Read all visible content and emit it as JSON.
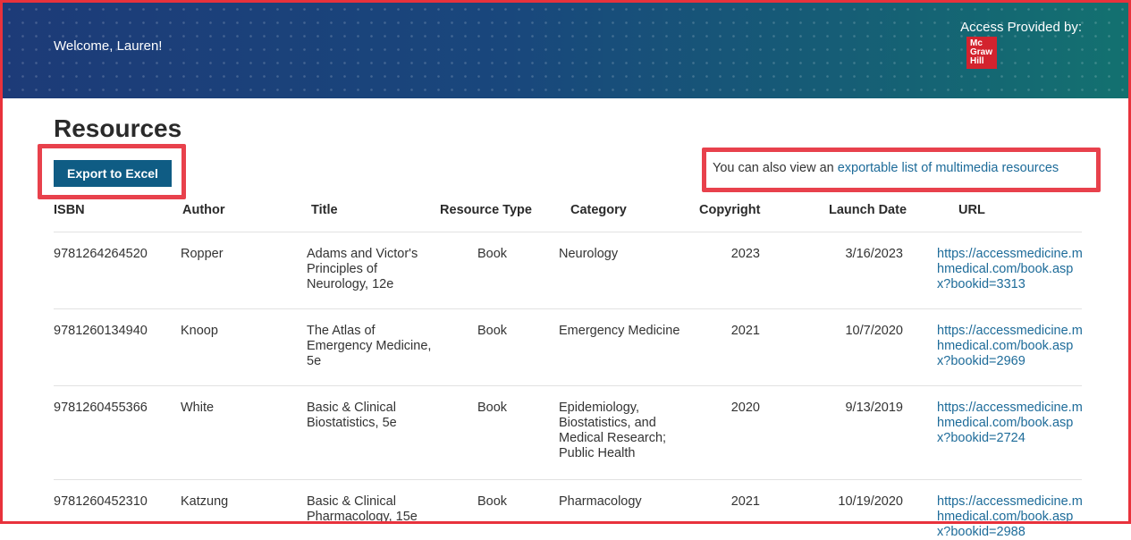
{
  "header": {
    "welcome": "Welcome, Lauren!",
    "access_label": "Access Provided by:",
    "logo_lines": [
      "Mc",
      "Graw",
      "Hill"
    ]
  },
  "page": {
    "title": "Resources",
    "export_button": "Export to Excel",
    "also_view_prefix": "You can also view an ",
    "also_view_link": "exportable list of multimedia resources"
  },
  "table": {
    "headers": [
      "ISBN",
      "Author",
      "Title",
      "Resource Type",
      "Category",
      "Copyright",
      "Launch Date",
      "URL"
    ],
    "rows": [
      {
        "isbn": "9781264264520",
        "author": "Ropper",
        "title": "Adams and Victor's Principles of Neurology, 12e",
        "type": "Book",
        "category": "Neurology",
        "copyright": "2023",
        "launch": "3/16/2023",
        "url": "https://accessmedicine.mhmedical.com/book.aspx?bookid=3313"
      },
      {
        "isbn": "9781260134940",
        "author": "Knoop",
        "title": "The Atlas of Emergency Medicine, 5e",
        "type": "Book",
        "category": "Emergency Medicine",
        "copyright": "2021",
        "launch": "10/7/2020",
        "url": "https://accessmedicine.mhmedical.com/book.aspx?bookid=2969"
      },
      {
        "isbn": "9781260455366",
        "author": "White",
        "title": "Basic & Clinical Biostatistics, 5e",
        "type": "Book",
        "category": "Epidemiology, Biostatistics, and Medical Research; Public Health",
        "copyright": "2020",
        "launch": "9/13/2019",
        "url": "https://accessmedicine.mhmedical.com/book.aspx?bookid=2724"
      },
      {
        "isbn": "9781260452310",
        "author": "Katzung",
        "title": "Basic & Clinical Pharmacology, 15e",
        "type": "Book",
        "category": "Pharmacology",
        "copyright": "2021",
        "launch": "10/19/2020",
        "url": "https://accessmedicine.mhmedical.com/book.aspx?bookid=2988"
      }
    ]
  }
}
